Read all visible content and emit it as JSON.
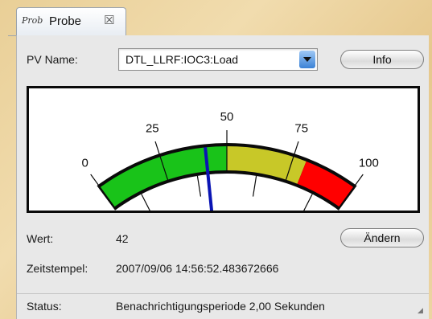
{
  "tab": {
    "icon_text": "Prob",
    "icon_name": "probe-app-icon",
    "title": "Probe",
    "close_glyph": "☒"
  },
  "pv": {
    "label": "PV Name:",
    "selected_value": "DTL_LLRF:IOC3:Load",
    "info_button": "Info"
  },
  "meter": {
    "min": 0,
    "max": 100,
    "value": 42,
    "ticks": [
      "0",
      "25",
      "50",
      "75",
      "100"
    ],
    "zones": [
      {
        "from": 0,
        "to": 50,
        "color": "#19c319"
      },
      {
        "from": 50,
        "to": 80,
        "color": "#c8c828"
      },
      {
        "from": 80,
        "to": 100,
        "color": "#ff0000"
      }
    ],
    "needle_color": "#0a14b4"
  },
  "value": {
    "label": "Wert:",
    "text": "42",
    "change_button": "Ändern"
  },
  "timestamp": {
    "label": "Zeitstempel:",
    "text": "2007/09/06 14:56:52.483672666"
  },
  "status": {
    "label": "Status:",
    "text": "Benachrichtigungsperiode 2,00 Sekunden"
  }
}
